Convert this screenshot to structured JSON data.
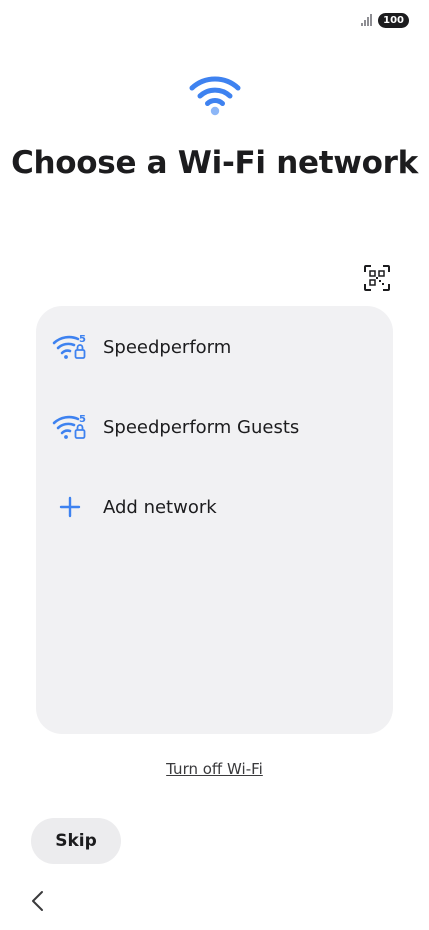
{
  "status_bar": {
    "battery_level": "100",
    "signal_icon": "signal-bars-icon"
  },
  "header": {
    "title": "Choose a Wi-Fi network",
    "icon": "wifi-icon"
  },
  "qr_scan": {
    "icon": "qr-scan-icon"
  },
  "networks": [
    {
      "name": "Speedperform",
      "icon": "wifi-5ghz-locked-icon"
    },
    {
      "name": "Speedperform Guests",
      "icon": "wifi-5ghz-locked-icon"
    }
  ],
  "add_network": {
    "label": "Add network",
    "icon": "plus-icon"
  },
  "footer": {
    "turn_off_label": "Turn off Wi-Fi",
    "skip_label": "Skip",
    "back_icon": "chevron-left-icon"
  },
  "colors": {
    "accent": "#3e82f0",
    "accent_light": "#8cb6f7",
    "card_bg": "#f1f1f3",
    "text": "#1c1c1e"
  }
}
